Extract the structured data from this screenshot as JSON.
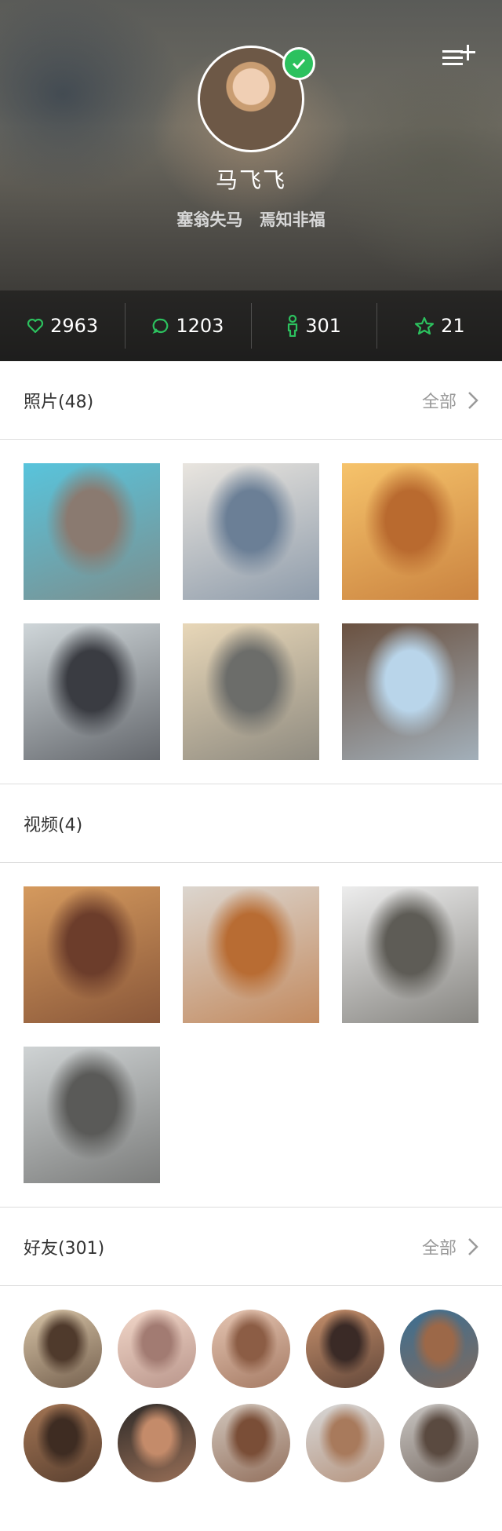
{
  "profile": {
    "name": "马飞飞",
    "motto": "塞翁失马 焉知非福",
    "verified": true,
    "menu_icon": "list-add-icon"
  },
  "stats": [
    {
      "icon": "heart-icon",
      "value": "2963"
    },
    {
      "icon": "comment-icon",
      "value": "1203"
    },
    {
      "icon": "person-icon",
      "value": "301"
    },
    {
      "icon": "star-icon",
      "value": "21"
    }
  ],
  "photos": {
    "title": "照片(48)",
    "see_all": "全部",
    "items": [
      {
        "alt": "friends",
        "color_a": "#58c4dc",
        "color_b": "#8a7a70"
      },
      {
        "alt": "man-glasses",
        "color_a": "#e9e5df",
        "color_b": "#6b7f96"
      },
      {
        "alt": "runner",
        "color_a": "#f6c36b",
        "color_b": "#b96a2f"
      },
      {
        "alt": "woman-stretch",
        "color_a": "#cfd6d9",
        "color_b": "#3a3c42"
      },
      {
        "alt": "woman-cafe",
        "color_a": "#e8d7b8",
        "color_b": "#6c6d6a"
      },
      {
        "alt": "man-headphones",
        "color_a": "#6a5140",
        "color_b": "#b9d5ea"
      }
    ]
  },
  "videos": {
    "title": "视频(4)",
    "items": [
      {
        "alt": "woman-smile",
        "color_a": "#d59a5e",
        "color_b": "#6c3d2b"
      },
      {
        "alt": "fox-snow",
        "color_a": "#dcd6cf",
        "color_b": "#b86c33"
      },
      {
        "alt": "kettlebell",
        "color_a": "#ededed",
        "color_b": "#5e5c56"
      },
      {
        "alt": "pier-jump",
        "color_a": "#cfd3d4",
        "color_b": "#5a5a58"
      }
    ]
  },
  "friends": {
    "title": "好友(301)",
    "see_all": "全部",
    "items": [
      {
        "color_a": "#d6c3a6",
        "color_b": "#4f3a2c"
      },
      {
        "color_a": "#f2d7c9",
        "color_b": "#a27b72"
      },
      {
        "color_a": "#e5c5b2",
        "color_b": "#8c5d45"
      },
      {
        "color_a": "#c58f6b",
        "color_b": "#3a2a26"
      },
      {
        "color_a": "#3b6f93",
        "color_b": "#9c6848"
      },
      {
        "color_a": "#a37554",
        "color_b": "#3e2c22"
      },
      {
        "color_a": "#2d2a28",
        "color_b": "#c48b6a"
      },
      {
        "color_a": "#d2c7bd",
        "color_b": "#7a4e37"
      },
      {
        "color_a": "#d8d8d8",
        "color_b": "#a87a5c"
      },
      {
        "color_a": "#c9c6c3",
        "color_b": "#5a4a40"
      }
    ]
  },
  "colors": {
    "accent": "#2cc15e",
    "divider": "#dddddd"
  }
}
